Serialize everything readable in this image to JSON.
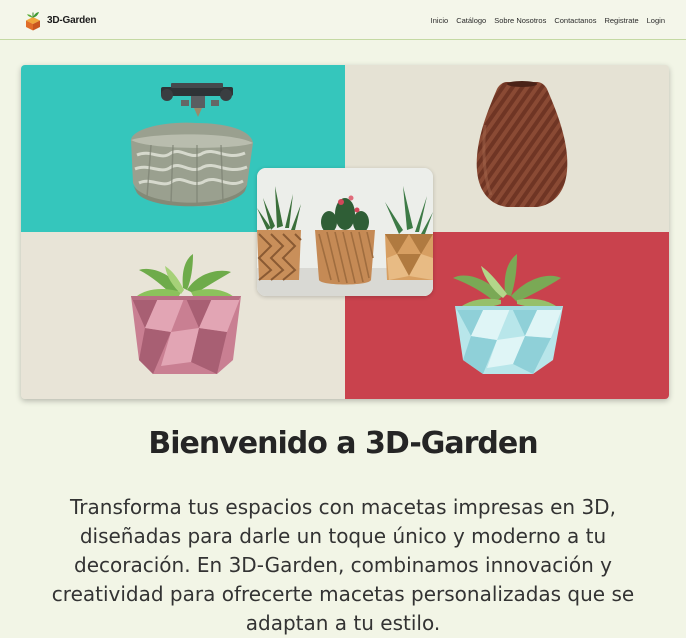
{
  "brand": {
    "name": "3D-Garden",
    "logo_icon": "cube-plant-logo"
  },
  "nav": {
    "links": [
      {
        "label": "Inicio"
      },
      {
        "label": "Catálogo"
      },
      {
        "label": "Sobre Nosotros"
      },
      {
        "label": "Contactanos"
      },
      {
        "label": "Registrate"
      },
      {
        "label": "Login"
      }
    ]
  },
  "hero": {
    "images": [
      "3d-printer-grey-pot",
      "brown-spiral-vase",
      "three-succulent-pots",
      "pink-geometric-succulent-pot",
      "mint-geometric-succulent-pot"
    ],
    "colors": {
      "teal": "#35c6bc",
      "cream": "#e5e2d4",
      "red": "#c9424d"
    }
  },
  "main": {
    "heading": "Bienvenido a 3D-Garden",
    "intro": "Transforma tus espacios con macetas impresas en 3D, diseñadas para darle un toque único y moderno a tu decoración. En 3D-Garden, combinamos innovación y creatividad para ofrecerte macetas personalizadas que se adaptan a tu estilo."
  }
}
